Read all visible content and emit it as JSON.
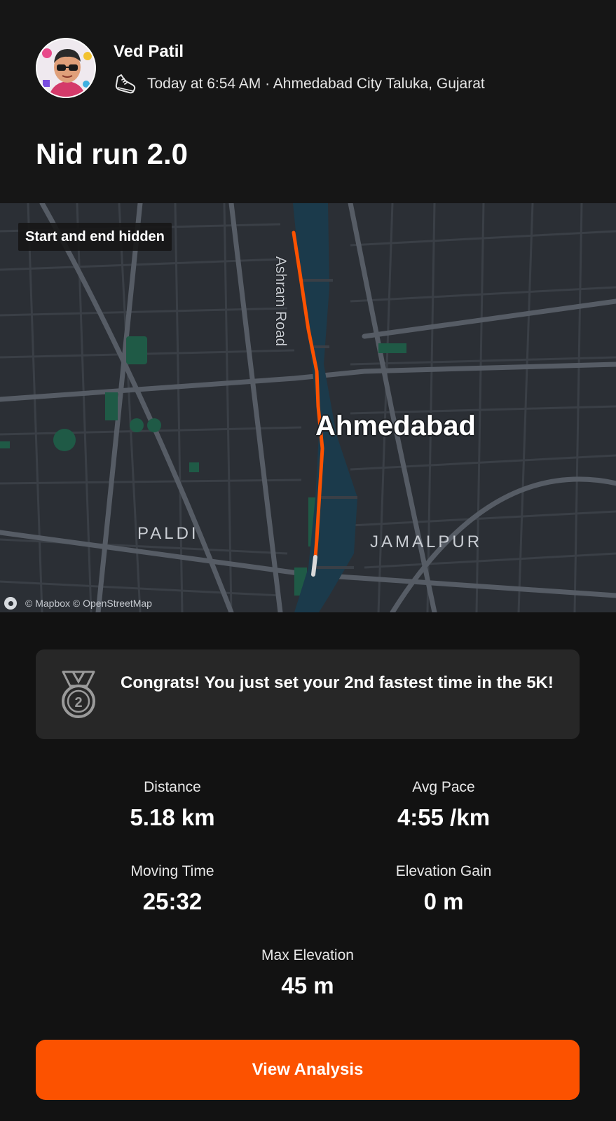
{
  "activity": {
    "athlete_name": "Ved Patil",
    "activity_icon": "running-shoe-icon",
    "meta": "Today at 6:54 AM · Ahmedabad City Taluka, Gujarat",
    "title": "Nid run 2.0"
  },
  "map": {
    "privacy_badge": "Start and end hidden",
    "labels": {
      "road": "Ashram Road",
      "city": "Ahmedabad",
      "area_left": "PALDI",
      "area_right": "JAMALPUR"
    },
    "attribution": "© Mapbox © OpenStreetMap",
    "route_color": "#fc5200",
    "water_color": "#1b3a4b",
    "park_color": "#1f5a46"
  },
  "achievement": {
    "icon": "medal-2-icon",
    "text": "Congrats! You just set your 2nd fastest time in the 5K!"
  },
  "stats": [
    {
      "label": "Distance",
      "value": "5.18 km"
    },
    {
      "label": "Avg Pace",
      "value": "4:55 /km"
    },
    {
      "label": "Moving Time",
      "value": "25:32"
    },
    {
      "label": "Elevation Gain",
      "value": "0 m"
    },
    {
      "label": "Max Elevation",
      "value": "45 m"
    }
  ],
  "actions": {
    "view_analysis": "View Analysis"
  },
  "colors": {
    "accent": "#fc5200",
    "background": "#121212",
    "card": "#272727"
  }
}
